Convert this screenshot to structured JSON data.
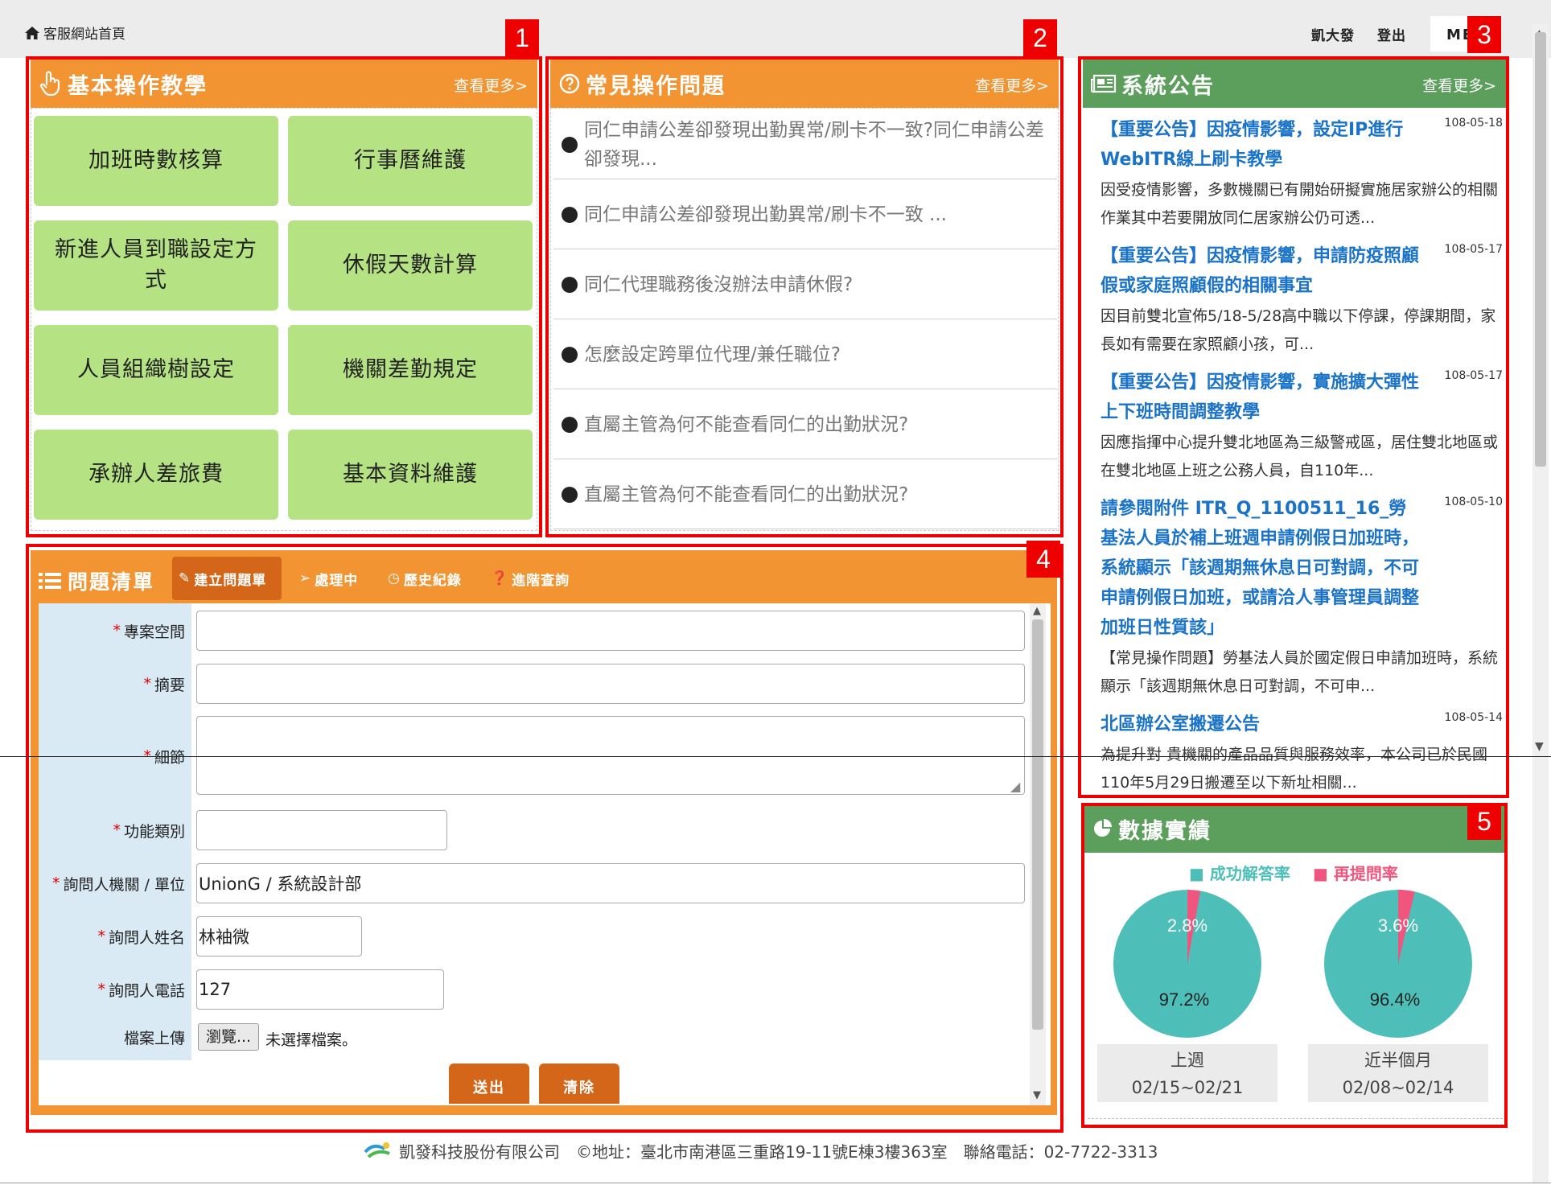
{
  "topbar": {
    "home_label": "客服網站首頁",
    "user_name": "凱大發",
    "logout_label": "登出",
    "menu_label": "ME"
  },
  "annotations": [
    "1",
    "2",
    "3",
    "4",
    "5"
  ],
  "tutorials": {
    "title": "基本操作教學",
    "more": "查看更多>",
    "items": [
      "加班時數核算",
      "行事曆維護",
      "新進人員到職設定方式",
      "休假天數計算",
      "人員組織樹設定",
      "機關差勤規定",
      "承辦人差旅費",
      "基本資料維護"
    ]
  },
  "faq": {
    "title": "常見操作問題",
    "more": "查看更多>",
    "items": [
      "同仁申請公差卻發現出勤異常/刷卡不一致?同仁申請公差卻發現...",
      "同仁申請公差卻發現出勤異常/刷卡不一致 ...",
      "同仁代理職務後沒辦法申請休假?",
      "怎麼設定跨單位代理/兼任職位?",
      "直屬主管為何不能查看同仁的出勤狀況?",
      "直屬主管為何不能查看同仁的出勤狀況?"
    ]
  },
  "announcements": {
    "title": "系統公告",
    "more": "查看更多>",
    "items": [
      {
        "title": "【重要公告】因疫情影響，設定IP進行WebITR線上刷卡教學",
        "date": "108-05-18",
        "body": "因受疫情影響，多數機關已有開始研擬實施居家辦公的相關作業其中若要開放同仁居家辦公仍可透..."
      },
      {
        "title": "【重要公告】因疫情影響，申請防疫照顧假或家庭照顧假的相關事宜",
        "date": "108-05-17",
        "body": "因目前雙北宣佈5/18-5/28高中職以下停課，停課期間，家長如有需要在家照顧小孩，可..."
      },
      {
        "title": "【重要公告】因疫情影響，實施擴大彈性上下班時間調整教學",
        "date": "108-05-17",
        "body": "因應指揮中心提升雙北地區為三級警戒區，居住雙北地區或在雙北地區上班之公務人員，自110年..."
      },
      {
        "title": "請參閱附件 ITR_Q_1100511_16_勞基法人員於補上班週申請例假日加班時，系統顯示「該週期無休息日可對調，不可申請例假日加班，或請洽人事管理員調整加班日性質該」",
        "date": "108-05-10",
        "body": "【常見操作問題】勞基法人員於國定假日申請加班時，系統顯示「該週期無休息日可對調，不可申..."
      },
      {
        "title": "北區辦公室搬遷公告",
        "date": "108-05-14",
        "body": "為提升對 貴機關的產品品質與服務效率，本公司已於民國110年5月29日搬遷至以下新址相關..."
      }
    ]
  },
  "stats": {
    "title": "數據實績",
    "legend": [
      "成功解答率",
      "再提問率"
    ],
    "colors": {
      "success": "#4dbfb8",
      "reask": "#f0557d"
    },
    "pies": [
      {
        "period": "上週",
        "range": "02/15~02/21",
        "success_pct": "97.2%",
        "reask_pct": "2.8%",
        "success": 97.2,
        "reask": 2.8
      },
      {
        "period": "近半個月",
        "range": "02/08~02/14",
        "success_pct": "96.4%",
        "reask_pct": "3.6%",
        "success": 96.4,
        "reask": 3.6
      }
    ]
  },
  "issues": {
    "title": "問題清單",
    "tabs": [
      "建立問題單",
      "處理中",
      "歷史紀錄",
      "進階查詢"
    ],
    "fields": {
      "project": {
        "label": "專案空間",
        "value": ""
      },
      "summary": {
        "label": "摘要",
        "value": ""
      },
      "detail": {
        "label": "細節",
        "value": ""
      },
      "category": {
        "label": "功能類別",
        "value": ""
      },
      "org": {
        "label": "詢問人機關 / 單位",
        "value": "UnionG / 系統設計部"
      },
      "name": {
        "label": "詢問人姓名",
        "value": "林袖微"
      },
      "phone": {
        "label": "詢問人電話",
        "value": "127"
      },
      "upload": {
        "label": "檔案上傳",
        "button": "瀏覽...",
        "status": "未選擇檔案。"
      }
    },
    "submit": "送出",
    "clear": "清除"
  },
  "footer": {
    "company": "凱發科技股份有限公司",
    "address": "©地址：臺北市南港區三重路19-11號E棟3樓363室",
    "phone": "聯絡電話：02-7722-3313"
  }
}
